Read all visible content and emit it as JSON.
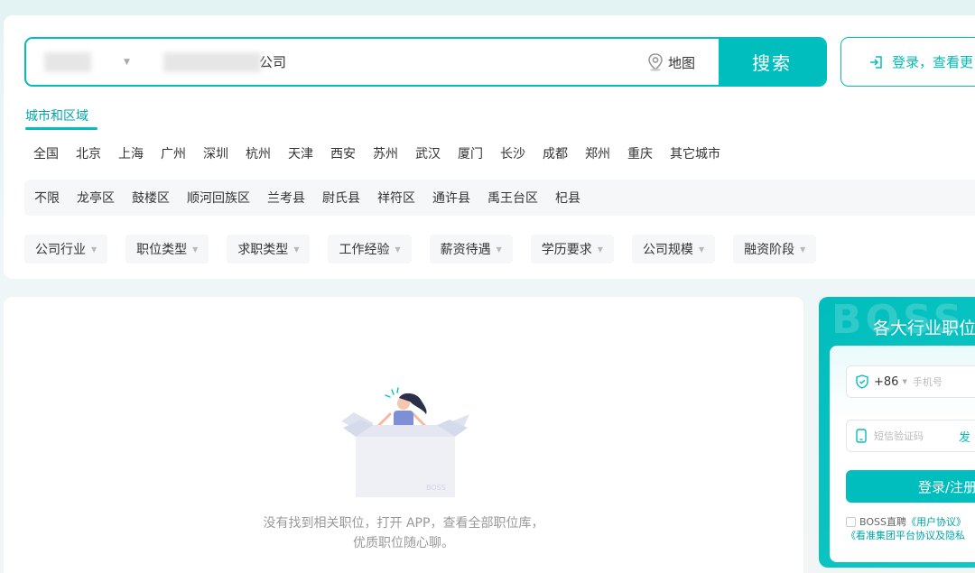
{
  "search": {
    "city_value": "",
    "keyword_suffix": "公司",
    "map_label": "地图",
    "search_button": "搜索"
  },
  "header": {
    "login_label": "登录，查看更"
  },
  "filter_section": {
    "tab_label": "城市和区域",
    "cities": [
      "全国",
      "北京",
      "上海",
      "广州",
      "深圳",
      "杭州",
      "天津",
      "西安",
      "苏州",
      "武汉",
      "厦门",
      "长沙",
      "成都",
      "郑州",
      "重庆",
      "其它城市"
    ],
    "districts": [
      "不限",
      "龙亭区",
      "鼓楼区",
      "顺河回族区",
      "兰考县",
      "尉氏县",
      "祥符区",
      "通许县",
      "禹王台区",
      "杞县"
    ],
    "filters": [
      "公司行业",
      "职位类型",
      "求职类型",
      "工作经验",
      "薪资待遇",
      "学历要求",
      "公司规模",
      "融资阶段"
    ]
  },
  "results": {
    "empty_line1": "没有找到相关职位，打开 APP，查看全部职位库，",
    "empty_line2": "优质职位随心聊。",
    "box_label": "BOSS"
  },
  "sidebar": {
    "watermark": "BOSS",
    "title": "各大行业职位任",
    "country_code": "+86",
    "phone_placeholder": "手机号",
    "code_placeholder": "短信验证码",
    "send_code": "发",
    "register_button": "登录/注册",
    "agree_prefix": "BOSS直聘",
    "agree_link1": "《用户协议》",
    "agree_link2": "《看准集团平台协议及隐私"
  },
  "colors": {
    "accent": "#00bebd"
  }
}
